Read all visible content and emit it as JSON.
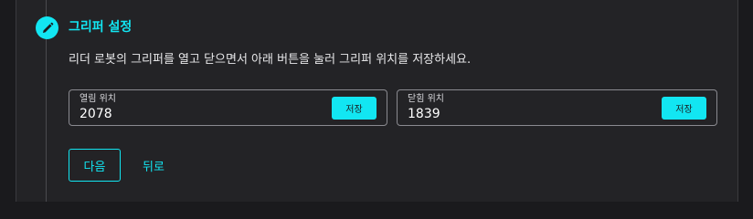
{
  "step": {
    "icon": "pencil-icon",
    "title": "그리퍼 설정",
    "instructions": "리더 로봇의 그리퍼를 열고 닫으면서 아래 버튼을 눌러 그리퍼 위치를 저장하세요."
  },
  "fields": {
    "open": {
      "label": "열림 위치",
      "value": "2078",
      "save_label": "저장"
    },
    "close": {
      "label": "닫힘 위치",
      "value": "1839",
      "save_label": "저장"
    }
  },
  "actions": {
    "next_label": "다음",
    "back_label": "뒤로"
  },
  "colors": {
    "accent": "#12e6f2",
    "background": "#1a1a1d",
    "panel": "#232326"
  }
}
